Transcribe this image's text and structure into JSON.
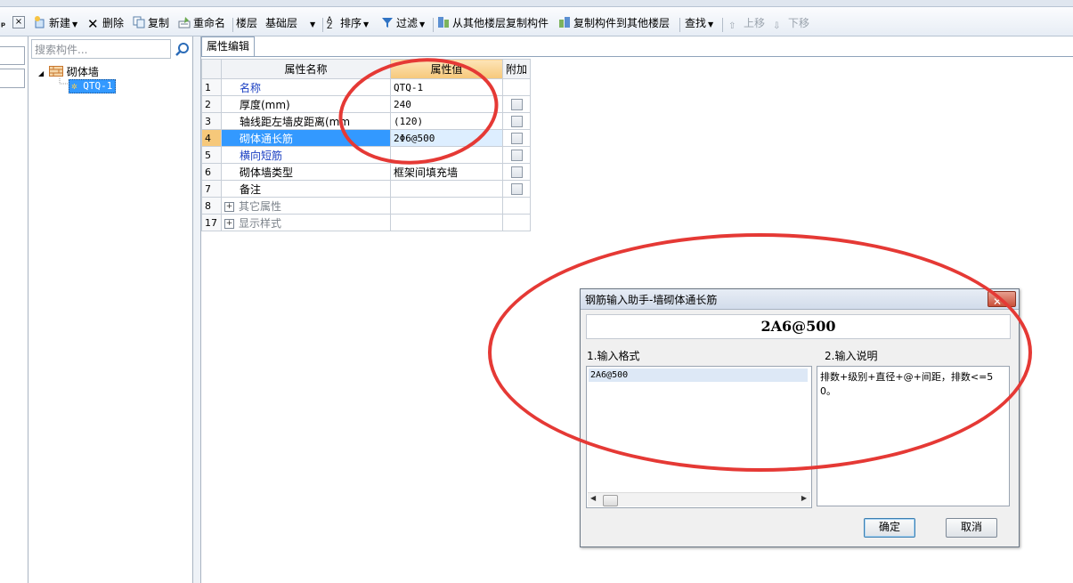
{
  "toolbar": {
    "new_label": "新建",
    "delete_label": "删除",
    "copy_label": "复制",
    "rename_label": "重命名",
    "floor_label": "楼层",
    "floor_value": "基础层",
    "sort_label": "排序",
    "filter_label": "过滤",
    "copy_from_floor_label": "从其他楼层复制构件",
    "copy_to_floor_label": "复制构件到其他楼层",
    "find_label": "查找",
    "move_up_label": "上移",
    "move_down_label": "下移"
  },
  "tree": {
    "search_placeholder": "搜索构件...",
    "root_label": "砌体墙",
    "child_label": "QTQ-1"
  },
  "props": {
    "tab_label": "属性编辑",
    "headers": {
      "name": "属性名称",
      "value": "属性值",
      "extra": "附加"
    },
    "rows": [
      {
        "num": "1",
        "name": "名称",
        "value": "QTQ-1"
      },
      {
        "num": "2",
        "name": "厚度(mm)",
        "value": "240"
      },
      {
        "num": "3",
        "name": "轴线距左墙皮距离(mm",
        "value": "(120)"
      },
      {
        "num": "4",
        "name": "砌体通长筋",
        "value": "2Φ6@500"
      },
      {
        "num": "5",
        "name": "横向短筋",
        "value": ""
      },
      {
        "num": "6",
        "name": "砌体墙类型",
        "value": "框架间填充墙"
      },
      {
        "num": "7",
        "name": "备注",
        "value": ""
      },
      {
        "num": "8",
        "name": "其它属性",
        "value": ""
      },
      {
        "num": "17",
        "name": "显示样式",
        "value": ""
      }
    ]
  },
  "dialog": {
    "title": "钢筋输入助手-墙砌体通长筋",
    "input_value": "2A6@500",
    "format_label": "1.输入格式",
    "desc_label": "2.输入说明",
    "format_items": [
      "2A6@500"
    ],
    "description": "排数+级别+直径+@+间距，排数<=50。",
    "ok_label": "确定",
    "cancel_label": "取消"
  },
  "colors": {
    "annotation_red": "#e53935",
    "selection_blue": "#3399ff",
    "value_header_orange": "#f6c87a",
    "link_blue": "#1a3fc2"
  }
}
